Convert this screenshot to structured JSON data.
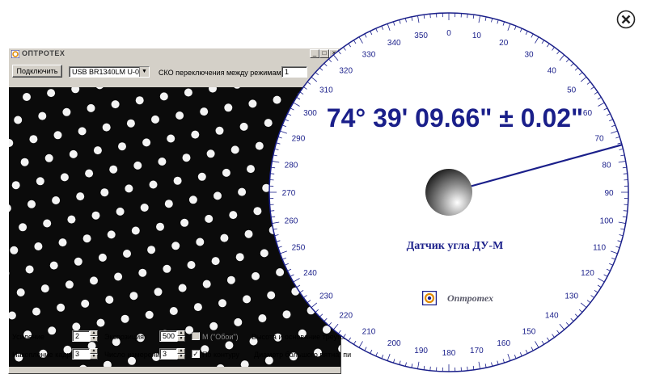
{
  "window": {
    "title": "ОПТРОТЕХ",
    "controls": [
      "_",
      "□",
      "×"
    ]
  },
  "toolbar": {
    "connect_label": "Подключить",
    "camera_select": "USB BR1340LM U-0",
    "rms_label": "СКО переключения между режимами, ''",
    "rms_value": "1"
  },
  "bottom_panel": {
    "gain_label": "Усиление",
    "gain_value": "2",
    "exposure_label": "Экспозиция",
    "exposure_value": "500",
    "m_flag_label": "М (\"Обои\")",
    "m_flag_checked": false,
    "height_label": "Высота и основание треугол",
    "accum_label": "Накопление кадров",
    "accum_value": "3",
    "measure_label": "Число измерений",
    "measure_value": "3",
    "contour_label": "По контуру",
    "contour_checked": true,
    "diameter_label": "Диаметр большого пятна, пи"
  },
  "dial": {
    "readout": "74° 39' 09.66\" ± 0.02\"",
    "angle_deg": 74.65,
    "sensor_title": "Датчик угла ДУ-М",
    "brand": "Оптротех",
    "tick_labels": [
      "0",
      "10",
      "20",
      "30",
      "40",
      "50",
      "60",
      "70",
      "80",
      "90",
      "100",
      "110",
      "120",
      "130",
      "140",
      "150",
      "160",
      "170",
      "180",
      "190",
      "200",
      "210",
      "220",
      "230",
      "240",
      "250",
      "260",
      "270",
      "280",
      "290",
      "300",
      "310",
      "320",
      "330",
      "340",
      "350"
    ]
  },
  "colors": {
    "accent": "#1a1f8a",
    "window_face": "#d4d0c8",
    "image_bg": "#0b0b0b"
  },
  "icons": {
    "close": "close-circle-icon",
    "logo": "optrotech-logo-icon"
  }
}
